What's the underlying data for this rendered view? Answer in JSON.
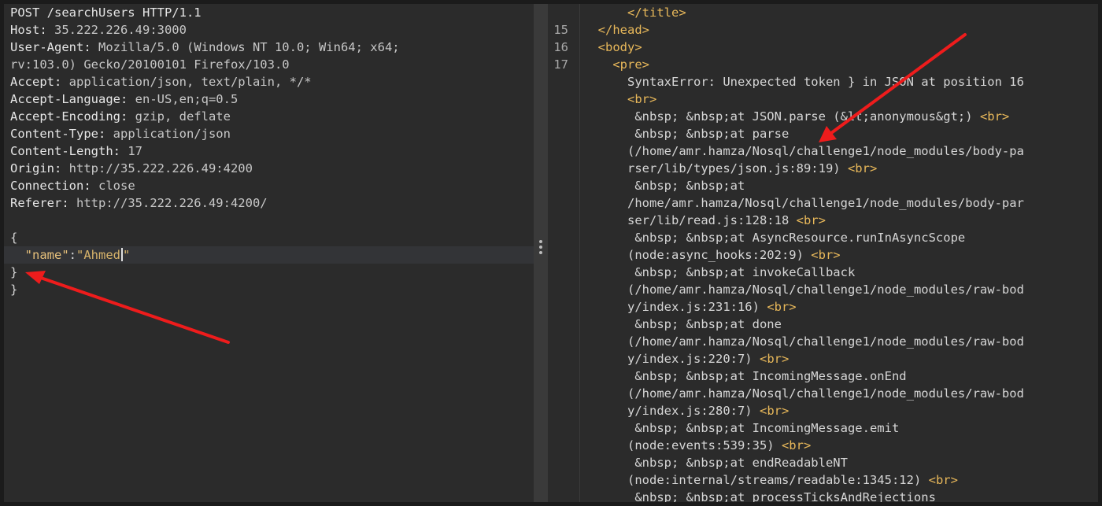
{
  "request": {
    "request_line": "POST /searchUsers HTTP/1.1",
    "headers": [
      {
        "name": "Host",
        "value": "35.222.226.49:3000"
      },
      {
        "name": "User-Agent",
        "value": "Mozilla/5.0 (Windows NT 10.0; Win64; x64;"
      },
      {
        "name": "",
        "value": "rv:103.0) Gecko/20100101 Firefox/103.0"
      },
      {
        "name": "Accept",
        "value": "application/json, text/plain, */*"
      },
      {
        "name": "Accept-Language",
        "value": "en-US,en;q=0.5"
      },
      {
        "name": "Accept-Encoding",
        "value": "gzip, deflate"
      },
      {
        "name": "Content-Type",
        "value": "application/json"
      },
      {
        "name": "Content-Length",
        "value": "17"
      },
      {
        "name": "Origin",
        "value": "http://35.222.226.49:4200"
      },
      {
        "name": "Connection",
        "value": "close"
      },
      {
        "name": "Referer",
        "value": "http://35.222.226.49:4200/"
      }
    ],
    "body": {
      "open_brace": "{",
      "key": "\"name\"",
      "colon": ":",
      "value": "\"Ahmed\"",
      "close_brace_1": "}",
      "close_brace_2": "}"
    }
  },
  "response": {
    "lines": [
      {
        "num": "",
        "indent": "      ",
        "parts": [
          {
            "t": "</title>",
            "c": "tag"
          }
        ]
      },
      {
        "num": "15",
        "indent": "  ",
        "parts": [
          {
            "t": "</head>",
            "c": "tag"
          }
        ]
      },
      {
        "num": "16",
        "indent": "  ",
        "parts": [
          {
            "t": "<body>",
            "c": "tag"
          }
        ]
      },
      {
        "num": "17",
        "indent": "    ",
        "parts": [
          {
            "t": "<pre>",
            "c": "tag"
          }
        ]
      },
      {
        "num": "",
        "indent": "      ",
        "parts": [
          {
            "t": "SyntaxError: Unexpected token } in JSON at position 16",
            "c": "txt"
          }
        ]
      },
      {
        "num": "",
        "indent": "      ",
        "parts": [
          {
            "t": "<br>",
            "c": "tag"
          }
        ]
      },
      {
        "num": "",
        "indent": "       ",
        "parts": [
          {
            "t": "&nbsp; &nbsp;at JSON.parse (&lt;anonymous&gt;) ",
            "c": "txt"
          },
          {
            "t": "<br>",
            "c": "tag"
          }
        ]
      },
      {
        "num": "",
        "indent": "       ",
        "parts": [
          {
            "t": "&nbsp; &nbsp;at parse",
            "c": "txt"
          }
        ]
      },
      {
        "num": "",
        "indent": "      ",
        "parts": [
          {
            "t": "(/home/amr.hamza/Nosql/challenge1/node_modules/body-pa",
            "c": "txt"
          }
        ]
      },
      {
        "num": "",
        "indent": "      ",
        "parts": [
          {
            "t": "rser/lib/types/json.js:89:19) ",
            "c": "txt"
          },
          {
            "t": "<br>",
            "c": "tag"
          }
        ]
      },
      {
        "num": "",
        "indent": "       ",
        "parts": [
          {
            "t": "&nbsp; &nbsp;at",
            "c": "txt"
          }
        ]
      },
      {
        "num": "",
        "indent": "      ",
        "parts": [
          {
            "t": "/home/amr.hamza/Nosql/challenge1/node_modules/body-par",
            "c": "txt"
          }
        ]
      },
      {
        "num": "",
        "indent": "      ",
        "parts": [
          {
            "t": "ser/lib/read.js:128:18 ",
            "c": "txt"
          },
          {
            "t": "<br>",
            "c": "tag"
          }
        ]
      },
      {
        "num": "",
        "indent": "       ",
        "parts": [
          {
            "t": "&nbsp; &nbsp;at AsyncResource.runInAsyncScope",
            "c": "txt"
          }
        ]
      },
      {
        "num": "",
        "indent": "      ",
        "parts": [
          {
            "t": "(node:async_hooks:202:9) ",
            "c": "txt"
          },
          {
            "t": "<br>",
            "c": "tag"
          }
        ]
      },
      {
        "num": "",
        "indent": "       ",
        "parts": [
          {
            "t": "&nbsp; &nbsp;at invokeCallback",
            "c": "txt"
          }
        ]
      },
      {
        "num": "",
        "indent": "      ",
        "parts": [
          {
            "t": "(/home/amr.hamza/Nosql/challenge1/node_modules/raw-bod",
            "c": "txt"
          }
        ]
      },
      {
        "num": "",
        "indent": "      ",
        "parts": [
          {
            "t": "y/index.js:231:16) ",
            "c": "txt"
          },
          {
            "t": "<br>",
            "c": "tag"
          }
        ]
      },
      {
        "num": "",
        "indent": "       ",
        "parts": [
          {
            "t": "&nbsp; &nbsp;at done",
            "c": "txt"
          }
        ]
      },
      {
        "num": "",
        "indent": "      ",
        "parts": [
          {
            "t": "(/home/amr.hamza/Nosql/challenge1/node_modules/raw-bod",
            "c": "txt"
          }
        ]
      },
      {
        "num": "",
        "indent": "      ",
        "parts": [
          {
            "t": "y/index.js:220:7) ",
            "c": "txt"
          },
          {
            "t": "<br>",
            "c": "tag"
          }
        ]
      },
      {
        "num": "",
        "indent": "       ",
        "parts": [
          {
            "t": "&nbsp; &nbsp;at IncomingMessage.onEnd",
            "c": "txt"
          }
        ]
      },
      {
        "num": "",
        "indent": "      ",
        "parts": [
          {
            "t": "(/home/amr.hamza/Nosql/challenge1/node_modules/raw-bod",
            "c": "txt"
          }
        ]
      },
      {
        "num": "",
        "indent": "      ",
        "parts": [
          {
            "t": "y/index.js:280:7) ",
            "c": "txt"
          },
          {
            "t": "<br>",
            "c": "tag"
          }
        ]
      },
      {
        "num": "",
        "indent": "       ",
        "parts": [
          {
            "t": "&nbsp; &nbsp;at IncomingMessage.emit",
            "c": "txt"
          }
        ]
      },
      {
        "num": "",
        "indent": "      ",
        "parts": [
          {
            "t": "(node:events:539:35) ",
            "c": "txt"
          },
          {
            "t": "<br>",
            "c": "tag"
          }
        ]
      },
      {
        "num": "",
        "indent": "       ",
        "parts": [
          {
            "t": "&nbsp; &nbsp;at endReadableNT",
            "c": "txt"
          }
        ]
      },
      {
        "num": "",
        "indent": "      ",
        "parts": [
          {
            "t": "(node:internal/streams/readable:1345:12) ",
            "c": "txt"
          },
          {
            "t": "<br>",
            "c": "tag"
          }
        ]
      },
      {
        "num": "",
        "indent": "       ",
        "parts": [
          {
            "t": "&nbsp; &nbsp;at processTicksAndRejections",
            "c": "txt"
          }
        ]
      }
    ]
  },
  "colors": {
    "arrow": "#ee1c1c",
    "tag": "#e8b85a",
    "json_key": "#e6c07b"
  }
}
